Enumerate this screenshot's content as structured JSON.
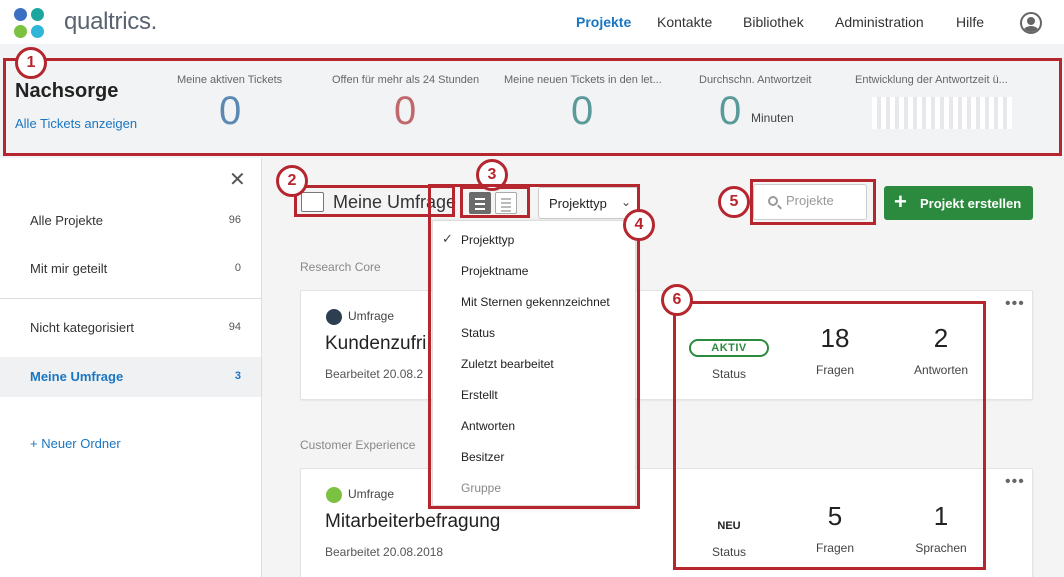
{
  "app": {
    "logo_text": "qualtrics."
  },
  "nav": {
    "items": [
      {
        "label": "Projekte",
        "active": true
      },
      {
        "label": "Kontakte"
      },
      {
        "label": "Bibliothek"
      },
      {
        "label": "Administration"
      },
      {
        "label": "Hilfe"
      }
    ]
  },
  "stats": {
    "title": "Nachsorge",
    "link": "Alle Tickets anzeigen",
    "items": [
      {
        "label": "Meine aktiven Tickets",
        "value": "0",
        "color": "#5a89b3"
      },
      {
        "label": "Offen für mehr als 24 Stunden",
        "value": "0",
        "color": "#c0686b"
      },
      {
        "label": "Meine neuen Tickets in den let...",
        "value": "0",
        "color": "#5a9a9a"
      },
      {
        "label": "Durchschn. Antwortzeit",
        "value": "0",
        "unit": "Minuten",
        "color": "#5a9a9a"
      },
      {
        "label": "Entwicklung der Antwortzeit ü..."
      }
    ]
  },
  "sidebar": {
    "items": [
      {
        "label": "Alle Projekte",
        "count": "96"
      },
      {
        "label": "Mit mir geteilt",
        "count": "0"
      },
      {
        "label": "Nicht kategorisiert",
        "count": "94"
      },
      {
        "label": "Meine Umfrage",
        "count": "3",
        "active": true
      }
    ],
    "new_folder": "Neuer Ordner"
  },
  "toolbar": {
    "folder_title": "Meine Umfrage",
    "dropdown_label": "Projekttyp",
    "search_placeholder": "Projekte",
    "create_label": "Projekt erstellen"
  },
  "menu": {
    "items": [
      {
        "label": "Projekttyp",
        "checked": true
      },
      {
        "label": "Projektname"
      },
      {
        "label": "Mit Sternen gekennzeichnet"
      },
      {
        "label": "Status"
      },
      {
        "label": "Zuletzt bearbeitet"
      },
      {
        "label": "Erstellt"
      },
      {
        "label": "Antworten"
      },
      {
        "label": "Besitzer"
      },
      {
        "label": "Gruppe",
        "disabled": true
      }
    ]
  },
  "sections": [
    {
      "label": "Research Core",
      "card": {
        "type": "Umfrage",
        "name": "Kundenzufri",
        "edited": "Bearbeitet 20.08.2",
        "status": "AKTIV",
        "status_label": "Status",
        "m2_value": "18",
        "m2_label": "Fragen",
        "m3_value": "2",
        "m3_label": "Antworten"
      }
    },
    {
      "label": "Customer Experience",
      "card": {
        "type": "Umfrage",
        "name": "Mitarbeiterbefragung",
        "edited": "Bearbeitet 20.08.2018",
        "status": "NEU",
        "status_label": "Status",
        "m2_value": "5",
        "m2_label": "Fragen",
        "m3_value": "1",
        "m3_label": "Sprachen"
      }
    }
  ],
  "annotations": [
    "1",
    "2",
    "3",
    "4",
    "5",
    "6"
  ],
  "colors": {
    "accent": "#1a76c2",
    "create": "#2b8a3e",
    "annotation": "#b5262f"
  }
}
